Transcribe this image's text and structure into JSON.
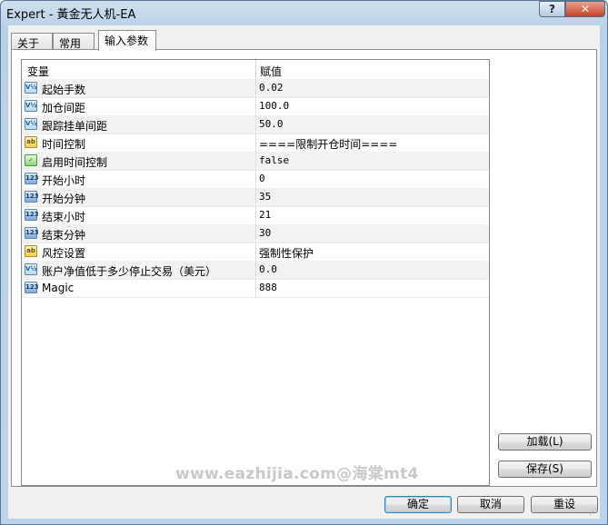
{
  "window": {
    "title": "Expert - 黃金无人机-EA",
    "help_label": "?",
    "close_label": "✕"
  },
  "tabs": [
    {
      "label": "关于"
    },
    {
      "label": "常用"
    },
    {
      "label": "输入参数",
      "active": true
    }
  ],
  "grid": {
    "col_variable": "变量",
    "col_value": "赋值",
    "rows": [
      {
        "icon": "double",
        "icon_text": "V½",
        "name": "起始手数",
        "value": "0.02"
      },
      {
        "icon": "double",
        "icon_text": "V½",
        "name": "加仓间距",
        "value": "100.0"
      },
      {
        "icon": "double",
        "icon_text": "V½",
        "name": "跟踪挂单间距",
        "value": "50.0"
      },
      {
        "icon": "string",
        "icon_text": "ab",
        "name": "时间控制",
        "value": "====限制开仓时间===="
      },
      {
        "icon": "bool",
        "icon_text": "✓",
        "name": "启用时间控制",
        "value": "false"
      },
      {
        "icon": "int",
        "icon_text": "123",
        "name": "开始小时",
        "value": "0"
      },
      {
        "icon": "int",
        "icon_text": "123",
        "name": "开始分钟",
        "value": "35"
      },
      {
        "icon": "int",
        "icon_text": "123",
        "name": "结束小时",
        "value": "21"
      },
      {
        "icon": "int",
        "icon_text": "123",
        "name": "结束分钟",
        "value": "30"
      },
      {
        "icon": "string",
        "icon_text": "ab",
        "name": "风控设置",
        "value": "强制性保护"
      },
      {
        "icon": "double",
        "icon_text": "V½",
        "name": "账户净值低于多少停止交易（美元）",
        "value": "0.0"
      },
      {
        "icon": "int",
        "icon_text": "123",
        "name": "Magic",
        "value": "888"
      }
    ]
  },
  "side_buttons": {
    "load": "加载(L)",
    "save": "保存(S)"
  },
  "watermark": "www.eazhijia.com@海棠mt4",
  "bottom_buttons": {
    "ok": "确定",
    "cancel": "取消",
    "reset": "重设"
  }
}
